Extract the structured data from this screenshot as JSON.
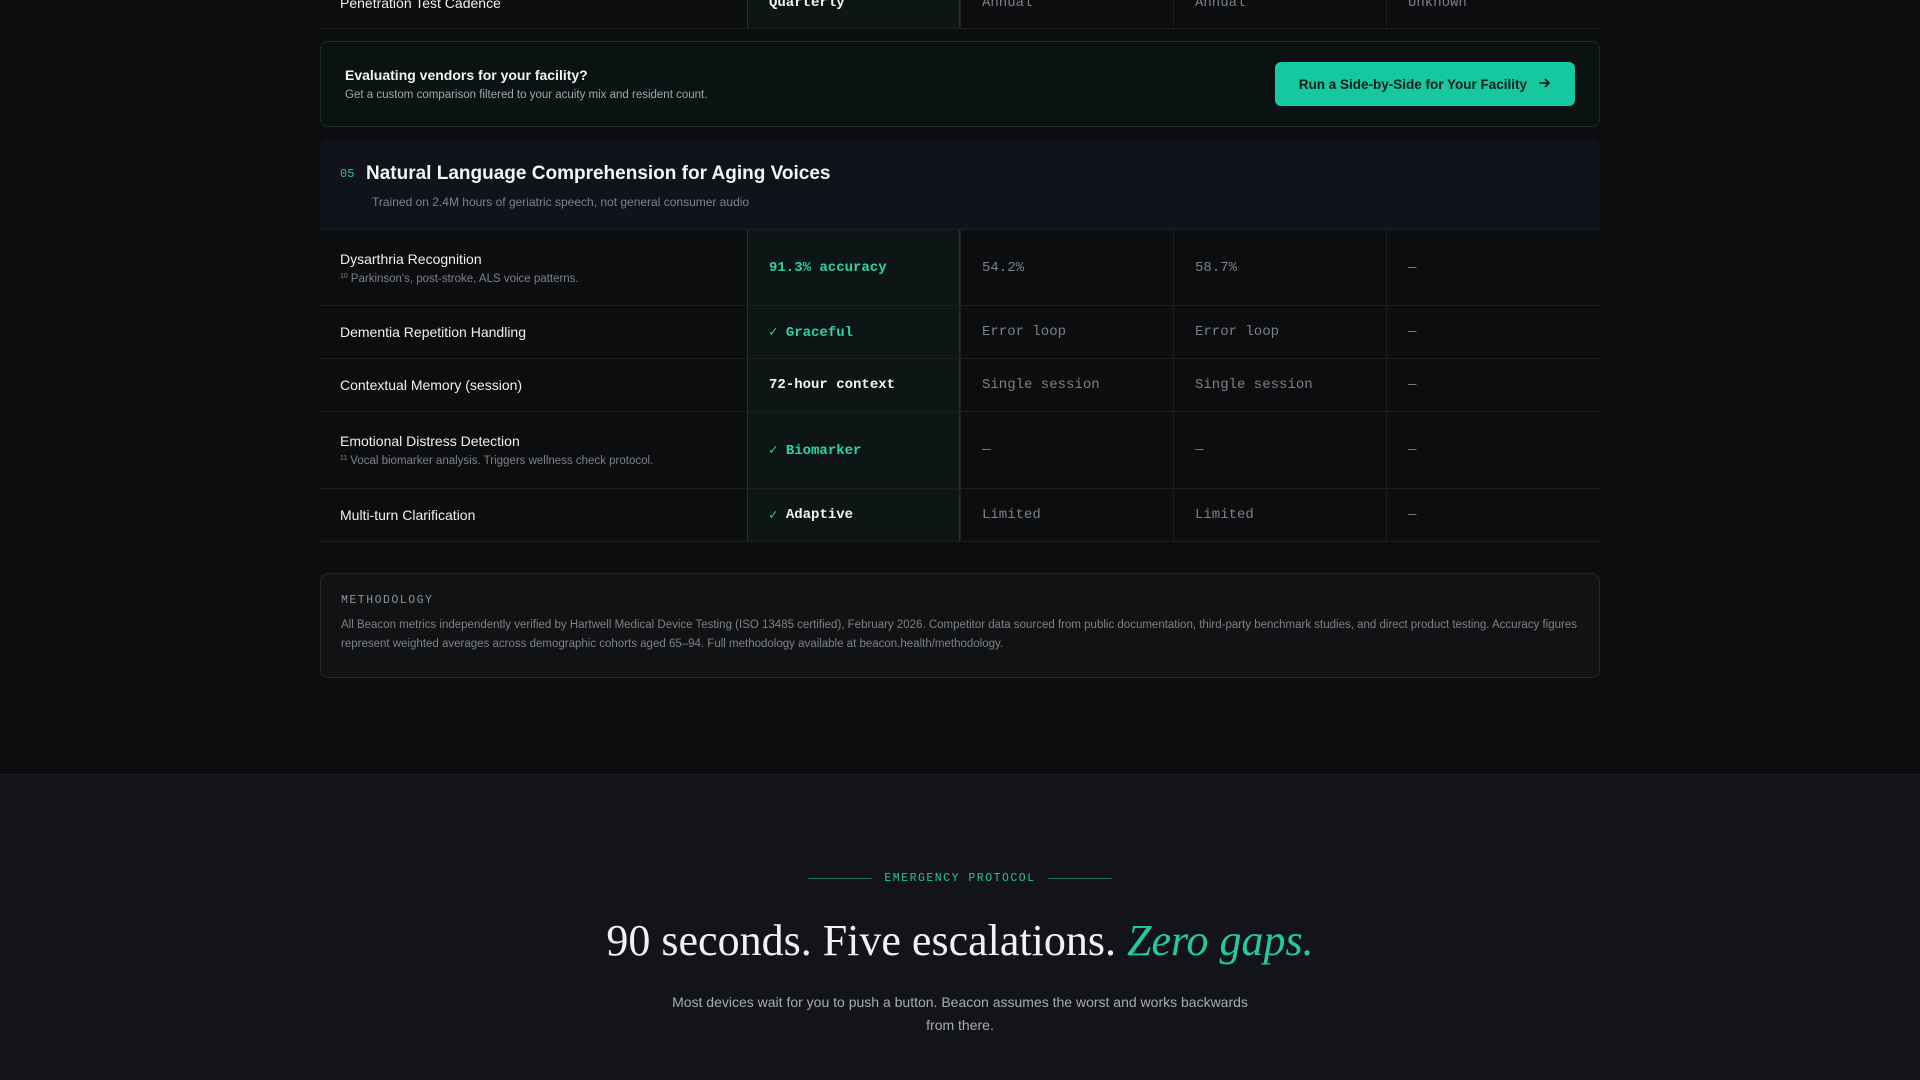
{
  "top_row": {
    "label": "Penetration Test Cadence",
    "values": [
      "Quarterly",
      "Annual",
      "Annual",
      "Unknown"
    ]
  },
  "cta": {
    "title": "Evaluating vendors for your facility?",
    "subtitle": "Get a custom comparison filtered to your acuity mix and resident count.",
    "button_label": "Run a Side-by-Side for Your Facility",
    "button_icon": "arrow-right-icon"
  },
  "section": {
    "number": "05",
    "title": "Natural Language Comprehension for Aging Voices",
    "subtitle": "Trained on 2.4M hours of geriatric speech, not general consumer audio"
  },
  "rows": [
    {
      "label": "Dysarthria Recognition",
      "note_ref": "10",
      "note": "Parkinson's, post-stroke, ALS voice patterns.",
      "beacon": "91.3% accuracy",
      "c2": "54.2%",
      "c3": "58.7%",
      "c4": "—"
    },
    {
      "label": "Dementia Repetition Handling",
      "beacon": "✓ Graceful",
      "c2": "Error loop",
      "c3": "Error loop",
      "c4": "—"
    },
    {
      "label": "Contextual Memory (session)",
      "beacon": "72-hour context",
      "c2": "Single session",
      "c3": "Single session",
      "c4": "—"
    },
    {
      "label": "Emotional Distress Detection",
      "note_ref": "11",
      "note": "Vocal biomarker analysis. Triggers wellness check protocol.",
      "beacon": "✓ Biomarker",
      "c2": "—",
      "c3": "—",
      "c4": "—"
    },
    {
      "label": "Multi-turn Clarification",
      "beacon_check": "✓",
      "beacon_text": "Adaptive",
      "c2": "Limited",
      "c3": "Limited",
      "c4": "—"
    }
  ],
  "methodology": {
    "label": "METHODOLOGY",
    "text": "All Beacon metrics independently verified by Hartwell Medical Device Testing (ISO 13485 certified), February 2026. Competitor data sourced from public documentation, third-party benchmark studies, and direct product testing. Accuracy figures represent weighted averages across demographic cohorts aged 65–94. Full methodology available at beacon.health/methodology."
  },
  "emergency": {
    "eyebrow": "EMERGENCY PROTOCOL",
    "headline_main": "90 seconds. Five escalations.",
    "headline_accent": "Zero gaps.",
    "lede": "Most devices wait for you to push a button. Beacon assumes the worst and works backwards from there."
  },
  "colors": {
    "background": "#0c0d0f",
    "accent": "#16c8a0",
    "accent_text": "#2ed1a8"
  }
}
